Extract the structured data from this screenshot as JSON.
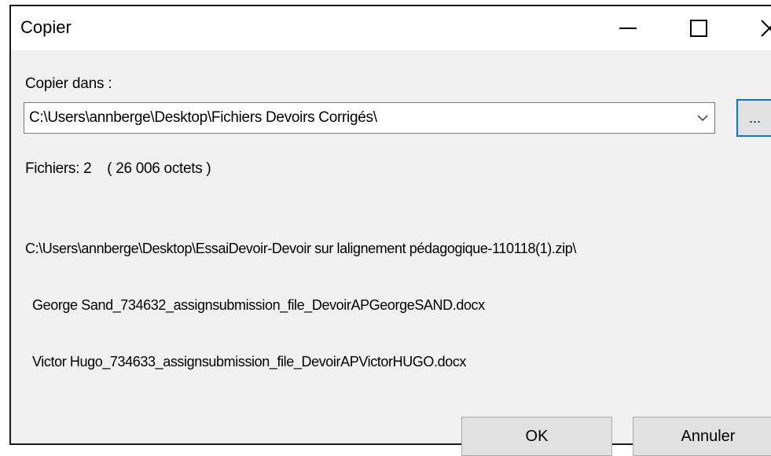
{
  "window": {
    "title": "Copier"
  },
  "destination": {
    "label": "Copier dans :",
    "path": "C:\\Users\\annberge\\Desktop\\Fichiers Devoirs Corrigés\\",
    "browse_label": "..."
  },
  "summary": {
    "text": "Fichiers: 2    ( 26 006 octets )"
  },
  "files": {
    "source": "C:\\Users\\annberge\\Desktop\\EssaiDevoir-Devoir sur lalignement pédagogique-110118(1).zip\\",
    "items": [
      "George Sand_734632_assignsubmission_file_DevoirAPGeorgeSAND.docx",
      "Victor Hugo_734633_assignsubmission_file_DevoirAPVictorHUGO.docx"
    ]
  },
  "buttons": {
    "ok": "OK",
    "cancel": "Annuler"
  },
  "icons": {
    "minimize": "minimize-icon",
    "maximize": "maximize-icon",
    "close": "close-icon",
    "dropdown": "chevron-down-icon"
  }
}
